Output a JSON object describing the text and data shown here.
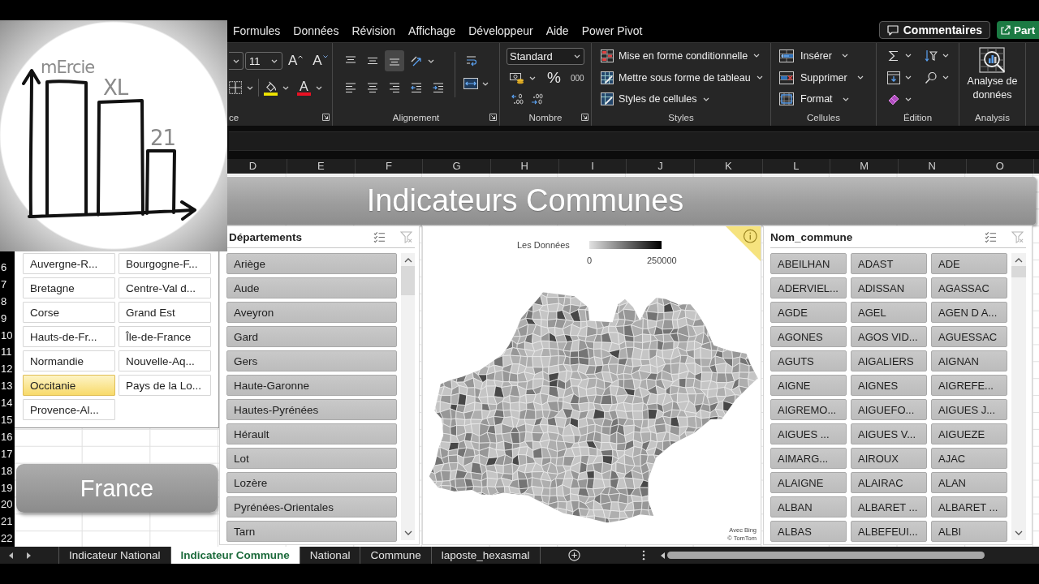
{
  "logo": {
    "words": [
      "mErcie",
      "XL",
      "21"
    ]
  },
  "menu": {
    "tabs": [
      {
        "label": "Formules",
        "selected": false
      },
      {
        "label": "Données",
        "selected": false
      },
      {
        "label": "Révision",
        "selected": false
      },
      {
        "label": "Affichage",
        "selected": false
      },
      {
        "label": "Développeur",
        "selected": false
      },
      {
        "label": "Aide",
        "selected": false
      },
      {
        "label": "Power Pivot",
        "selected": false
      }
    ],
    "buttons": [
      {
        "label": "Commentaires",
        "kind": "comments"
      },
      {
        "label": "Part",
        "kind": "share"
      }
    ]
  },
  "ribbon": {
    "font_group": {
      "label": "ce",
      "font_size": "11",
      "grow_glyph": "A",
      "shrink_glyph": "A",
      "color_glyph": "A"
    },
    "alignment_group": {
      "label": "Alignement",
      "vertical_buttons": [
        {
          "kind": "top",
          "selected": false
        },
        {
          "kind": "middle",
          "selected": false
        },
        {
          "kind": "bottom",
          "selected": true
        }
      ]
    },
    "number_group": {
      "label": "Nombre",
      "format": "Standard",
      "percent": "%",
      "thousands": "000"
    },
    "styles_group": {
      "label": "Styles",
      "commands": [
        {
          "label": "Mise en forme conditionnelle",
          "kind": "conditional"
        },
        {
          "label": "Mettre sous forme de tableau",
          "kind": "table"
        },
        {
          "label": "Styles de cellules",
          "kind": "cell_styles"
        }
      ]
    },
    "cells_group": {
      "label": "Cellules",
      "commands": [
        {
          "label": "Insérer",
          "kind": "insert"
        },
        {
          "label": "Supprimer",
          "kind": "delete"
        },
        {
          "label": "Format",
          "kind": "format"
        }
      ]
    },
    "editing_group": {
      "label": "Édition"
    },
    "analysis_group": {
      "label": "Analysis",
      "command": "Analyse de données"
    }
  },
  "columns": [
    "D",
    "E",
    "F",
    "G",
    "H",
    "I",
    "J",
    "K",
    "L",
    "M",
    "N",
    "O"
  ],
  "rows": [
    "6",
    "7",
    "8",
    "9",
    "10",
    "11",
    "12",
    "13",
    "14",
    "15",
    "16",
    "17",
    "18",
    "19",
    "20",
    "21",
    "22"
  ],
  "banner": {
    "title": "Indicateurs Communes"
  },
  "region_slicer": {
    "items": [
      {
        "label": "Auvergne-R...",
        "selected": false
      },
      {
        "label": "Bourgogne-F...",
        "selected": false
      },
      {
        "label": "Bretagne",
        "selected": false
      },
      {
        "label": "Centre-Val d...",
        "selected": false
      },
      {
        "label": "Corse",
        "selected": false
      },
      {
        "label": "Grand Est",
        "selected": false
      },
      {
        "label": "Hauts-de-Fr...",
        "selected": false
      },
      {
        "label": "Île-de-France",
        "selected": false
      },
      {
        "label": "Normandie",
        "selected": false
      },
      {
        "label": "Nouvelle-Aq...",
        "selected": false
      },
      {
        "label": "Occitanie",
        "selected": true
      },
      {
        "label": "Pays de la Lo...",
        "selected": false
      },
      {
        "label": "Provence-Al...",
        "selected": false
      }
    ]
  },
  "france_button": {
    "label": "France"
  },
  "departement_slicer": {
    "title": "Départements",
    "items": [
      {
        "label": "Ariège",
        "selected": true
      },
      {
        "label": "Aude",
        "selected": true
      },
      {
        "label": "Aveyron",
        "selected": true
      },
      {
        "label": "Gard",
        "selected": true
      },
      {
        "label": "Gers",
        "selected": true
      },
      {
        "label": "Haute-Garonne",
        "selected": true
      },
      {
        "label": "Hautes-Pyrénées",
        "selected": true
      },
      {
        "label": "Hérault",
        "selected": true
      },
      {
        "label": "Lot",
        "selected": true
      },
      {
        "label": "Lozère",
        "selected": true
      },
      {
        "label": "Pyrénées-Orientales",
        "selected": true
      },
      {
        "label": "Tarn",
        "selected": true
      }
    ]
  },
  "map": {
    "legend_title": "Les Données",
    "scale_min": "0",
    "scale_max": "250000",
    "attribution": [
      "Avec Bing",
      "© TomTom"
    ]
  },
  "commune_slicer": {
    "title": "Nom_commune",
    "items": [
      {
        "label": "ABEILHAN",
        "selected": true
      },
      {
        "label": "ADAST",
        "selected": true
      },
      {
        "label": "ADE",
        "selected": true
      },
      {
        "label": "ADERVIEL...",
        "selected": true
      },
      {
        "label": "ADISSAN",
        "selected": true
      },
      {
        "label": "AGASSAC",
        "selected": true
      },
      {
        "label": "AGDE",
        "selected": true
      },
      {
        "label": "AGEL",
        "selected": true
      },
      {
        "label": "AGEN D A...",
        "selected": true
      },
      {
        "label": "AGONES",
        "selected": true
      },
      {
        "label": "AGOS VID...",
        "selected": true
      },
      {
        "label": "AGUESSAC",
        "selected": true
      },
      {
        "label": "AGUTS",
        "selected": true
      },
      {
        "label": "AIGALIERS",
        "selected": true
      },
      {
        "label": "AIGNAN",
        "selected": true
      },
      {
        "label": "AIGNE",
        "selected": true
      },
      {
        "label": "AIGNES",
        "selected": true
      },
      {
        "label": "AIGREFE...",
        "selected": true
      },
      {
        "label": "AIGREMO...",
        "selected": true
      },
      {
        "label": "AIGUEFO...",
        "selected": true
      },
      {
        "label": "AIGUES J...",
        "selected": true
      },
      {
        "label": "AIGUES ...",
        "selected": true
      },
      {
        "label": "AIGUES V...",
        "selected": true
      },
      {
        "label": "AIGUEZE",
        "selected": true
      },
      {
        "label": "AIMARG...",
        "selected": true
      },
      {
        "label": "AIROUX",
        "selected": true
      },
      {
        "label": "AJAC",
        "selected": true
      },
      {
        "label": "ALAIGNE",
        "selected": true
      },
      {
        "label": "ALAIRAC",
        "selected": true
      },
      {
        "label": "ALAN",
        "selected": true
      },
      {
        "label": "ALBAN",
        "selected": true
      },
      {
        "label": "ALBARET ...",
        "selected": true
      },
      {
        "label": "ALBARET ...",
        "selected": true
      },
      {
        "label": "ALBAS",
        "selected": true
      },
      {
        "label": "ALBEFEUI...",
        "selected": true
      },
      {
        "label": "ALBI",
        "selected": true
      }
    ]
  },
  "sheet_tabs": [
    {
      "label": "Indicateur National",
      "selected": false
    },
    {
      "label": "Indicateur Commune",
      "selected": true
    },
    {
      "label": "National",
      "selected": false
    },
    {
      "label": "Commune",
      "selected": false
    },
    {
      "label": "laposte_hexasmal",
      "selected": false
    }
  ]
}
